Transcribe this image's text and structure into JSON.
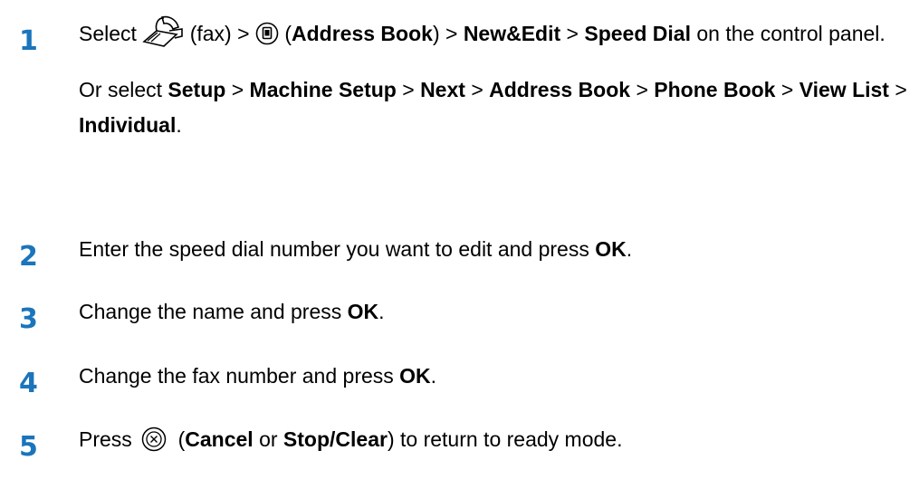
{
  "colors": {
    "step_number": "#1a75bc",
    "text": "#000000"
  },
  "steps": [
    {
      "number": "1",
      "icon_fax": "fax-icon",
      "icon_address_book": "address-book-icon",
      "t_select": "Select",
      "t_fax": "(fax) >",
      "t_open": "(",
      "address_book": "Address Book",
      "t_close": ") >",
      "new_edit": "New&Edit",
      "gt1": ">",
      "speed_dial": "Speed Dial",
      "t_on": "on the control panel.",
      "t_or_select": "Or select",
      "setup": "Setup",
      "gt2": ">",
      "machine_setup": "Machine Setup",
      "gt3": ">",
      "next": "Next",
      "gt4": ">",
      "address_book2": "Address Book",
      "gt5": ">",
      "phone_book": "Phone Book",
      "gt6": ">",
      "view_list": "View List",
      "gt7": ">",
      "individual": "Individual",
      "period": "."
    },
    {
      "number": "2",
      "t_before": "Enter the speed dial number you want to edit and press",
      "ok": "OK",
      "period": "."
    },
    {
      "number": "3",
      "t_before": "Change the name and press",
      "ok": "OK",
      "period": "."
    },
    {
      "number": "4",
      "t_before": "Change the fax number and press",
      "ok": "OK",
      "period": "."
    },
    {
      "number": "5",
      "icon_cancel": "cancel-icon",
      "t_press": "Press",
      "t_open": "(",
      "cancel": "Cancel",
      "t_or": "or",
      "stop_clear": "Stop/Clear",
      "t_after": ") to return to ready mode."
    }
  ]
}
